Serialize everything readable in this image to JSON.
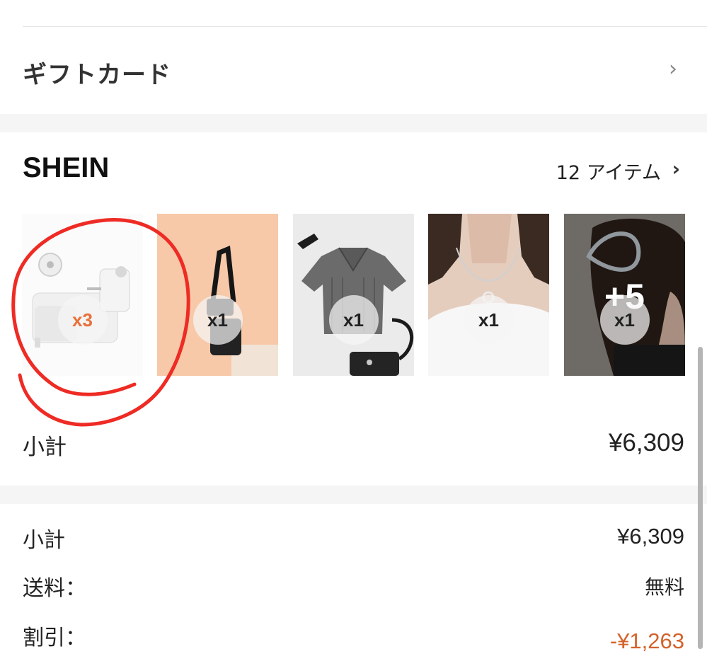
{
  "gift_card": {
    "label": "ギフトカード",
    "chevron": "›"
  },
  "store": {
    "name": "SHEIN",
    "item_count": "12 アイテム",
    "chevron": "›",
    "items": [
      {
        "qty": "x3",
        "image": "ear-piercing-kit"
      },
      {
        "qty": "x1",
        "image": "black-crossbody-bag"
      },
      {
        "qty": "x1",
        "image": "gray-ribbed-polo-crop-top"
      },
      {
        "qty": "x1",
        "image": "silver-pendant-necklace"
      },
      {
        "qty": "x1",
        "image": "hair-claw-clip",
        "more": "+5"
      }
    ],
    "subtotal_label": "小計",
    "subtotal_value": "¥6,309"
  },
  "summary": {
    "subtotal_label": "小計",
    "subtotal_value": "¥6,309",
    "shipping_label": "送料：",
    "shipping_value": "無料",
    "discount_label": "割引：",
    "discount_value": "-¥1,263"
  },
  "colors": {
    "accent_orange": "#e8703a",
    "discount": "#d4622b",
    "annotation_red": "#ee2b24",
    "separator": "#f5f5f5"
  }
}
